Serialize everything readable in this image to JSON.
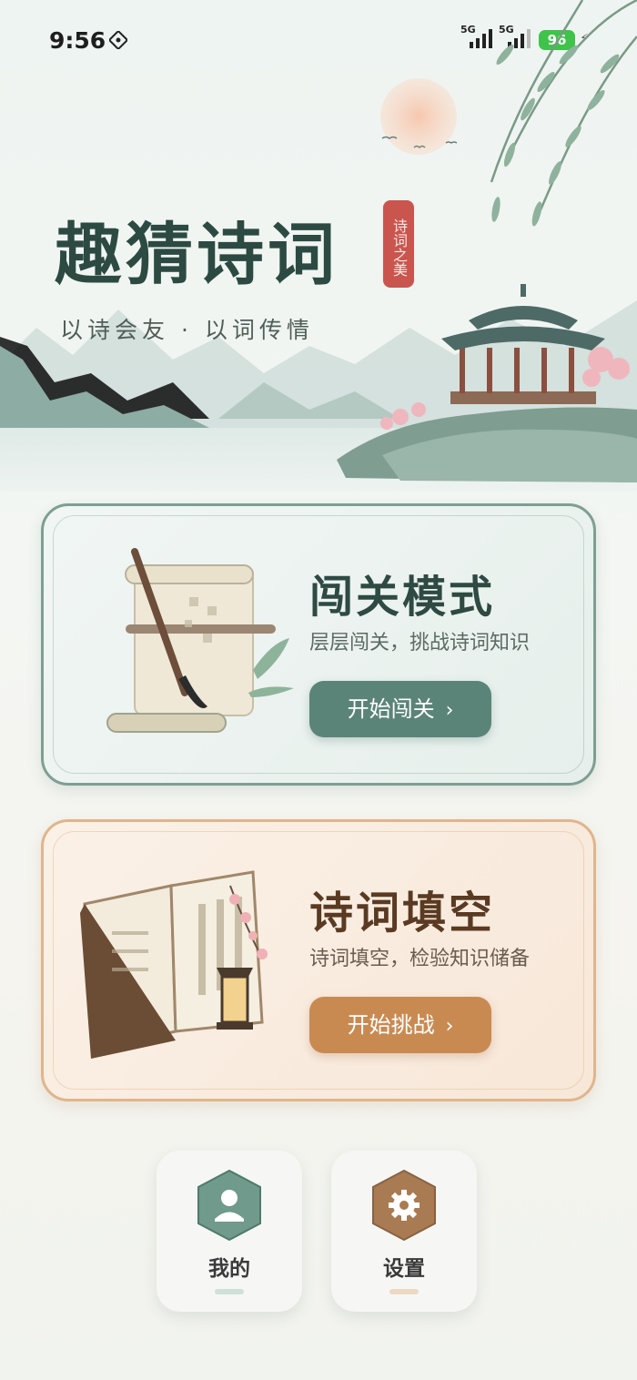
{
  "status_bar": {
    "time": "9:56",
    "signal_1_label": "5G",
    "signal_2_label": "5G",
    "battery": "96"
  },
  "header": {
    "title": "趣猜诗词",
    "seal": "诗词之美",
    "subtitle": "以诗会友 · 以词传情"
  },
  "modes": [
    {
      "title": "闯关模式",
      "description": "层层闯关，挑战诗词知识",
      "button_label": "开始闯关",
      "accent": "#5b8478"
    },
    {
      "title": "诗词填空",
      "description": "诗词填空，检验知识储备",
      "button_label": "开始挑战",
      "accent": "#c98a52"
    }
  ],
  "bottom_nav": [
    {
      "label": "我的",
      "icon": "user-icon",
      "accent": "#6f9a8c"
    },
    {
      "label": "设置",
      "icon": "gear-icon",
      "accent": "#a97b52"
    }
  ]
}
